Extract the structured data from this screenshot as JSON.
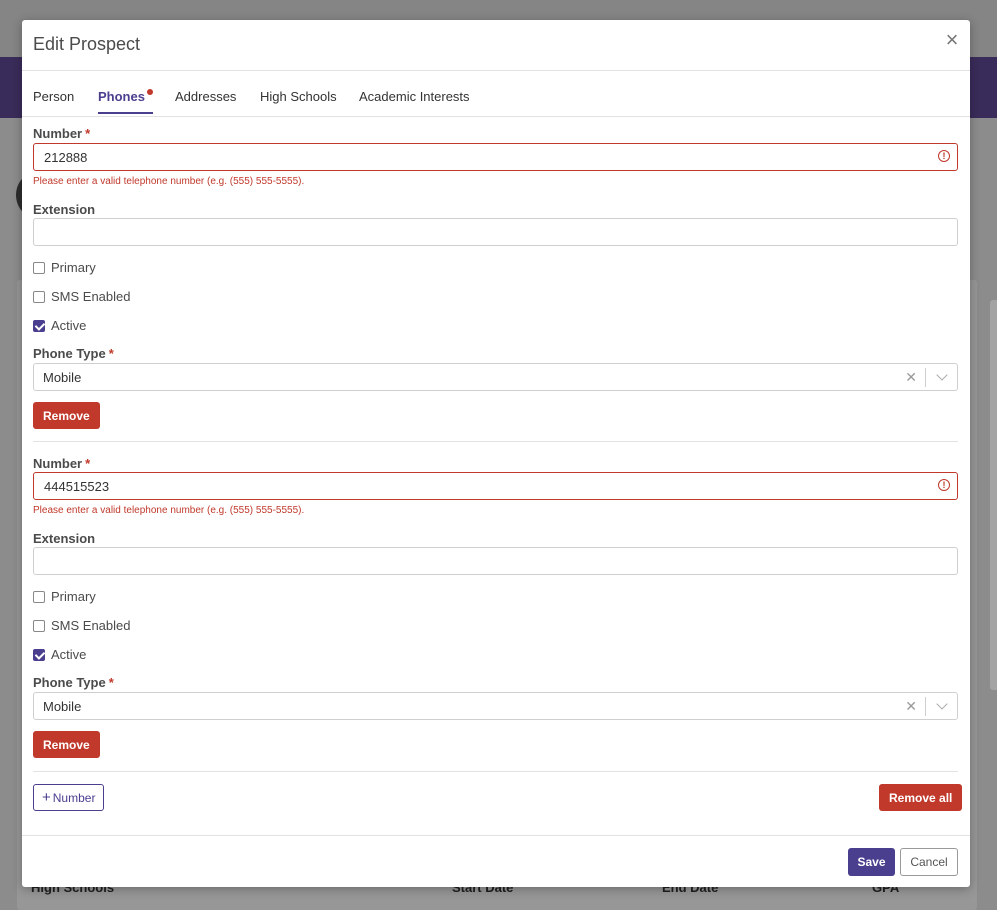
{
  "background": {
    "table_headers": [
      "High Schools",
      "Start Date",
      "End Date",
      "GPA"
    ]
  },
  "modal": {
    "title": "Edit Prospect",
    "close_icon": "close-icon"
  },
  "tabs": [
    {
      "label": "Person",
      "active": false
    },
    {
      "label": "Phones",
      "active": true,
      "has_error": true
    },
    {
      "label": "Addresses",
      "active": false
    },
    {
      "label": "High Schools",
      "active": false
    },
    {
      "label": "Academic Interests",
      "active": false
    }
  ],
  "labels": {
    "number": "Number",
    "extension": "Extension",
    "primary": "Primary",
    "sms_enabled": "SMS Enabled",
    "active": "Active",
    "phone_type": "Phone Type",
    "required_mark": "*",
    "remove": "Remove"
  },
  "phones": [
    {
      "number": "212888",
      "error": "Please enter a valid telephone number (e.g. (555) 555-5555).",
      "extension": "",
      "primary": false,
      "sms_enabled": false,
      "active": true,
      "phone_type": "Mobile"
    },
    {
      "number": "444515523",
      "error": "Please enter a valid telephone number (e.g. (555) 555-5555).",
      "extension": "",
      "primary": false,
      "sms_enabled": false,
      "active": true,
      "phone_type": "Mobile"
    }
  ],
  "actions": {
    "add_number": "Number",
    "remove_all": "Remove all",
    "save": "Save",
    "cancel": "Cancel"
  },
  "colors": {
    "accent": "#4a3f8f",
    "danger": "#c0392b"
  }
}
